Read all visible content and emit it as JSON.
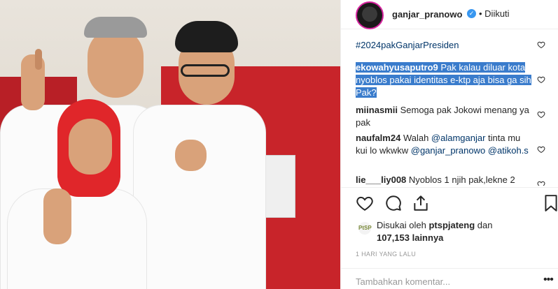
{
  "post": {
    "username": "ganjar_pranowo",
    "verified_icon": "verified-badge-icon",
    "follow_status": "• Diikuti"
  },
  "comments": [
    {
      "user": "",
      "text": "#2024pakGanjarPresiden"
    },
    {
      "user": "ekowahyusaputro9",
      "text": "Pak kalau diluar kota nyoblos pakai identitas e-ktp aja bisa ga sih Pak?"
    },
    {
      "user": "miinasmii",
      "text": "Semoga pak Jokowi menang ya pak"
    },
    {
      "user": "naufalm24",
      "text_before": "Walah ",
      "mention1": "@alamganjar",
      "text_mid": " tinta mu kui lo wkwkw ",
      "mention2": "@ganjar_pranowo",
      "text_mid2": " ",
      "mention3": "@atikoh.s"
    },
    {
      "user": "lie___liy008",
      "text": "Nyoblos 1 njih pak,lekne 2"
    }
  ],
  "likes": {
    "prefix": "Disukai oleh ",
    "user": "ptspjateng",
    "mid": " dan",
    "count": "107,153 lainnya",
    "avatar_text": "PtSP"
  },
  "timestamp": "1 HARI YANG LALU",
  "add_comment_placeholder": "Tambahkan komentar...",
  "more_label": "•••",
  "colors": {
    "accent": "#3897f0",
    "selection": "#3a7ccc",
    "photo_red": "#c8242a"
  }
}
